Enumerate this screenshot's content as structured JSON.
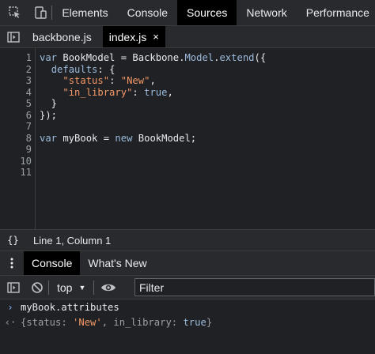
{
  "main_tabs": [
    "Elements",
    "Console",
    "Sources",
    "Network",
    "Performance"
  ],
  "active_main_tab": "Sources",
  "file_tabs": [
    {
      "label": "backbone.js",
      "active": false
    },
    {
      "label": "index.js",
      "active": true,
      "close": "×"
    }
  ],
  "editor": {
    "line_numbers": [
      "1",
      "2",
      "3",
      "4",
      "5",
      "6",
      "7",
      "8",
      "9",
      "10",
      "11"
    ],
    "lines": [
      [
        [
          "kw",
          "var "
        ],
        [
          "id",
          "BookModel = Backbone."
        ],
        [
          "kw",
          "Model"
        ],
        [
          "id",
          "."
        ],
        [
          "kw",
          "extend"
        ],
        [
          "id",
          "({"
        ]
      ],
      [
        [
          "id",
          "  "
        ],
        [
          "kw",
          "defaults"
        ],
        [
          "id",
          ": {"
        ]
      ],
      [
        [
          "id",
          "    "
        ],
        [
          "str",
          "\"status\""
        ],
        [
          "id",
          ": "
        ],
        [
          "str",
          "\"New\""
        ],
        [
          "id",
          ","
        ]
      ],
      [
        [
          "id",
          "    "
        ],
        [
          "str",
          "\"in_library\""
        ],
        [
          "id",
          ": "
        ],
        [
          "kw",
          "true"
        ],
        [
          "id",
          ","
        ]
      ],
      [
        [
          "id",
          "  }"
        ]
      ],
      [
        [
          "id",
          "});"
        ]
      ],
      [],
      [
        [
          "kw",
          "var "
        ],
        [
          "id",
          "myBook = "
        ],
        [
          "kw",
          "new "
        ],
        [
          "id",
          "BookModel;"
        ]
      ],
      [],
      [],
      []
    ]
  },
  "status": {
    "braces": "{}",
    "position": "Line 1, Column 1"
  },
  "drawer_tabs": [
    "Console",
    "What's New"
  ],
  "console_toolbar": {
    "context": "top",
    "filter_placeholder": "Filter"
  },
  "console": {
    "input_prompt": "›",
    "input": "myBook.attributes",
    "result_marker": "‹·",
    "result_parts": [
      {
        "t": "",
        "v": "{status: "
      },
      {
        "t": "s",
        "v": "'New'"
      },
      {
        "t": "",
        "v": ", in_library: "
      },
      {
        "t": "b",
        "v": "true"
      },
      {
        "t": "",
        "v": "}"
      }
    ]
  },
  "colors": {
    "keyword": "#9bbbdc",
    "string": "#f29766",
    "background": "#202124",
    "toolbar": "#292a2d"
  }
}
